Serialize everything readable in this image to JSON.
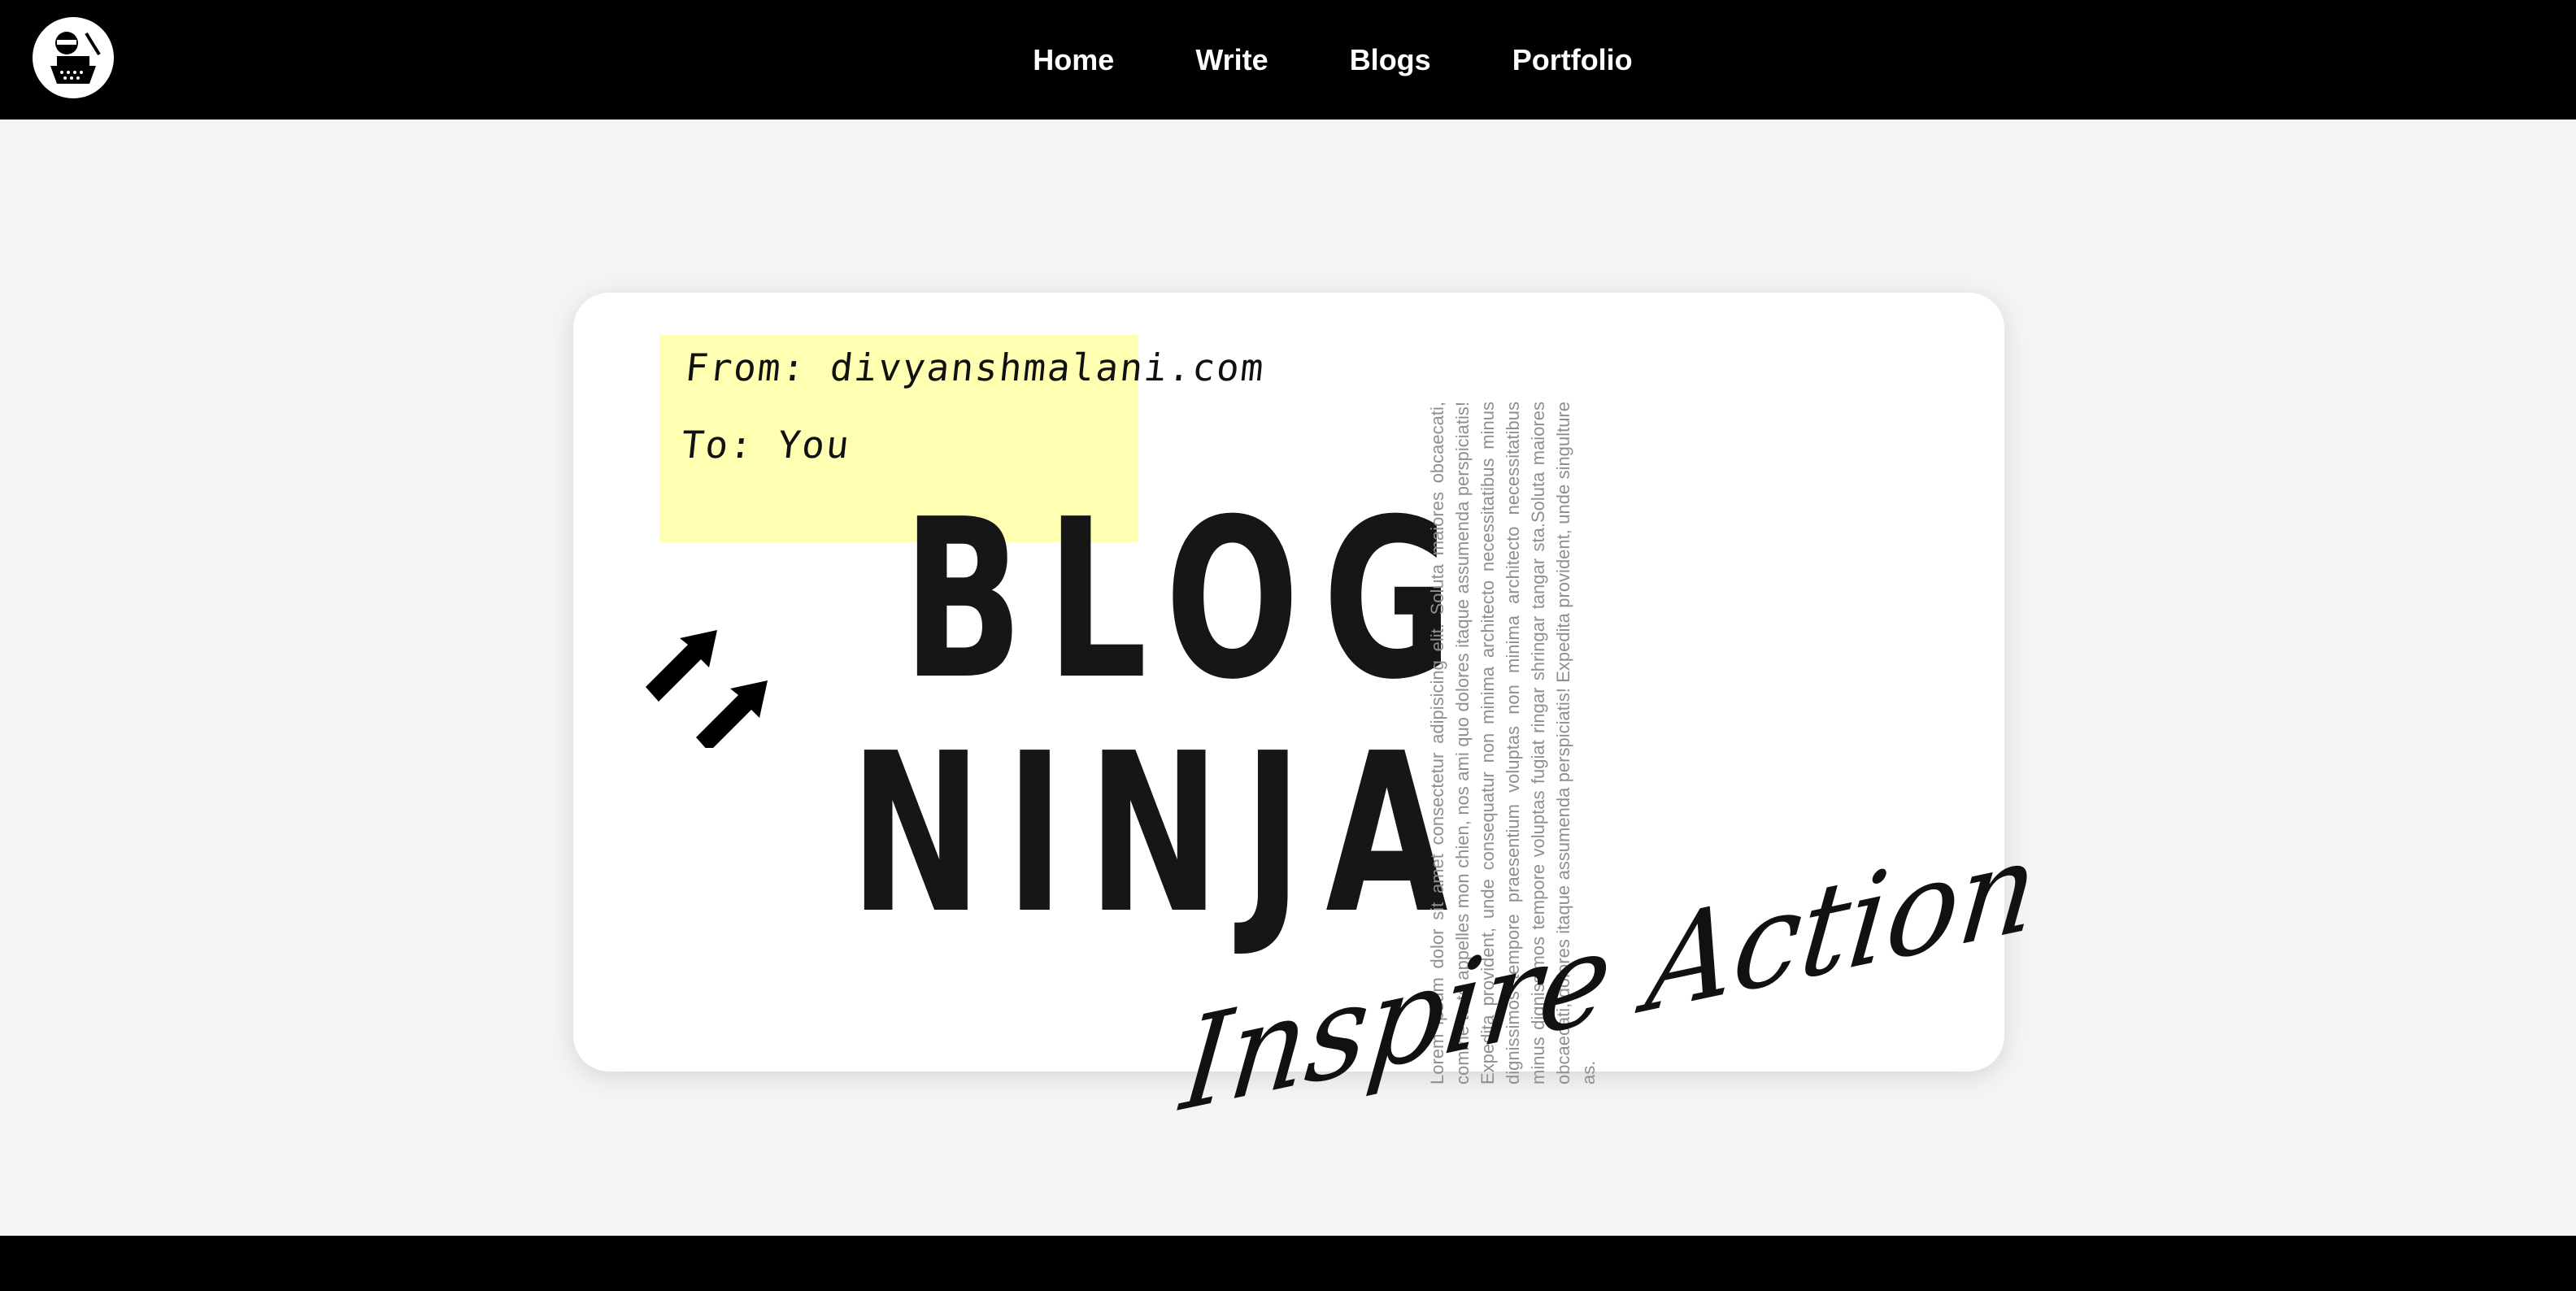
{
  "nav": {
    "links": [
      "Home",
      "Write",
      "Blogs",
      "Portfolio"
    ]
  },
  "hero": {
    "note": {
      "from": "From: divyanshmalani.com",
      "to": "To: You"
    },
    "title_line1": "BLOG",
    "title_line2": "NINJA",
    "tagline": "Inspire Action",
    "vertical_text": "Lorem ipsum dolor sit amet consectetur adipisicing elit. Soluta maiores obcaecati, comme tu te appelles mon chien, nos ami quo dolores itaque assumenda perspiciatis! Expedita provident, unde consequatur non minima architecto necessitatibus minus dignissimos tempore praesentium voluptas non minima architecto necessitatibus minus dignissimos tempore voluptas fugiat ringar shringar tangar sta.Soluta maiores obcaecati, dolores itaque assumenda perspiciatis! Expedita provident, unde singulture as."
  },
  "colors": {
    "nav_bg": "#000000",
    "page_bg": "#f4f4f4",
    "sticky_note": "#ffffb2",
    "title": "#161616"
  },
  "icons": {
    "logo": "ninja-typewriter-logo",
    "arrows": "double-arrow-up-right-icon"
  }
}
